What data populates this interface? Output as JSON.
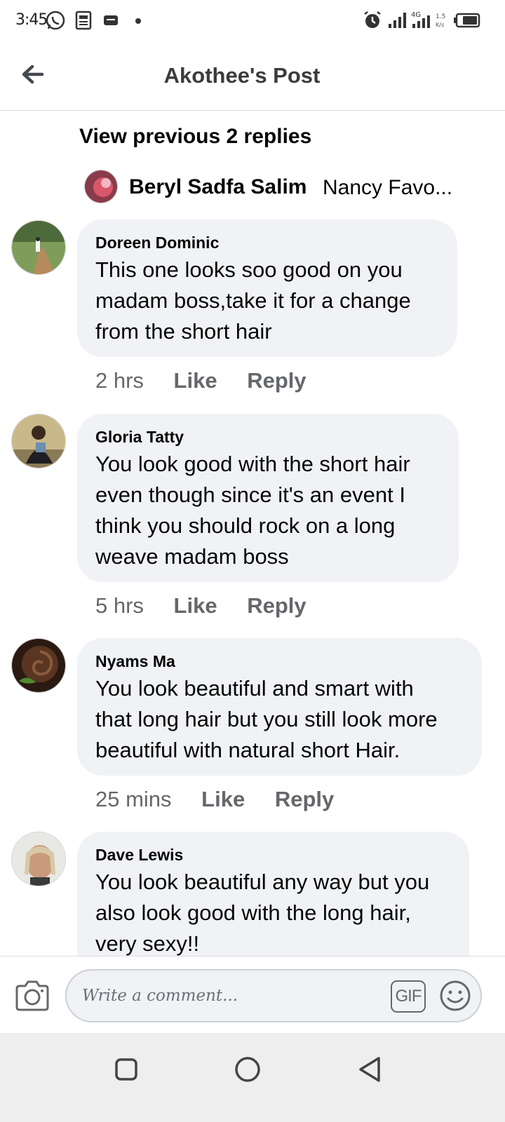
{
  "status_bar": {
    "time": "3:45",
    "icons": [
      "whatsapp-icon",
      "news-icon",
      "message-icon",
      "dot-icon",
      "alarm-icon",
      "signal-icon",
      "signal-4g-icon",
      "data-speed-icon",
      "battery-icon"
    ]
  },
  "header": {
    "title": "Akothee's Post",
    "back_icon": "arrow-left-icon"
  },
  "thread": {
    "view_previous": "View previous 2 replies",
    "latest_reply": {
      "name": "Beryl Sadfa Salim",
      "text": "Nancy Favo..."
    }
  },
  "comments": [
    {
      "name": "Doreen Dominic",
      "lines": [
        "This one looks soo good on you",
        "madam  boss,take it for a change",
        "from the short hair"
      ],
      "time": "2 hrs",
      "like": "Like",
      "reply": "Reply"
    },
    {
      "name": "Gloria Tatty",
      "lines": [
        "You look good with the short  hair",
        "even though since it's an event I",
        "think you should rock on a long",
        "weave madam boss"
      ],
      "time": "5 hrs",
      "like": "Like",
      "reply": "Reply"
    },
    {
      "name": "Nyams Ma",
      "lines": [
        "You look beautiful and smart with",
        "that long hair but you still look more",
        "beautiful with natural short Hair."
      ],
      "time": "25 mins",
      "like": "Like",
      "reply": "Reply"
    },
    {
      "name": "Dave Lewis",
      "lines": [
        "You look beautiful any way but you",
        "also look good with the long hair,",
        "very sexy!!"
      ],
      "time": "",
      "like": "",
      "reply": ""
    }
  ],
  "composer": {
    "placeholder": "Write a comment...",
    "gif_label": "GIF",
    "camera_icon": "camera-icon",
    "emoji_icon": "smiley-icon"
  },
  "nav": {
    "icons": [
      "recent-apps-icon",
      "home-icon",
      "back-icon"
    ]
  }
}
